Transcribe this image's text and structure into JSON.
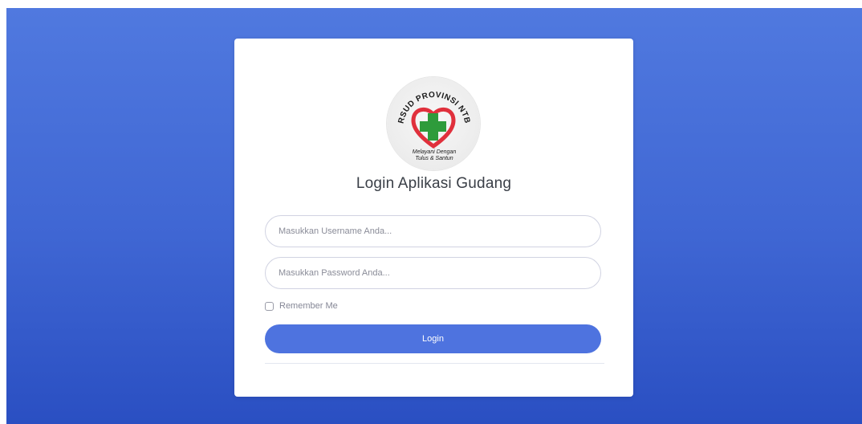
{
  "logo": {
    "arc_text": "RSUD PROVINSI NTB",
    "tagline_line1": "Melayani Dengan",
    "tagline_line2": "Tulus & Santun",
    "colors": {
      "heart": "#e0303c",
      "cross": "#2e9b3b",
      "text": "#1a1a1a"
    }
  },
  "login": {
    "title": "Login Aplikasi Gudang",
    "username_placeholder": "Masukkan Username Anda...",
    "password_placeholder": "Masukkan Password Anda...",
    "remember_label": "Remember Me",
    "remember_checked": false,
    "submit_label": "Login"
  },
  "theme": {
    "background_top": "#5079df",
    "background_bottom": "#2a4fc2",
    "button": "#4e73df"
  }
}
